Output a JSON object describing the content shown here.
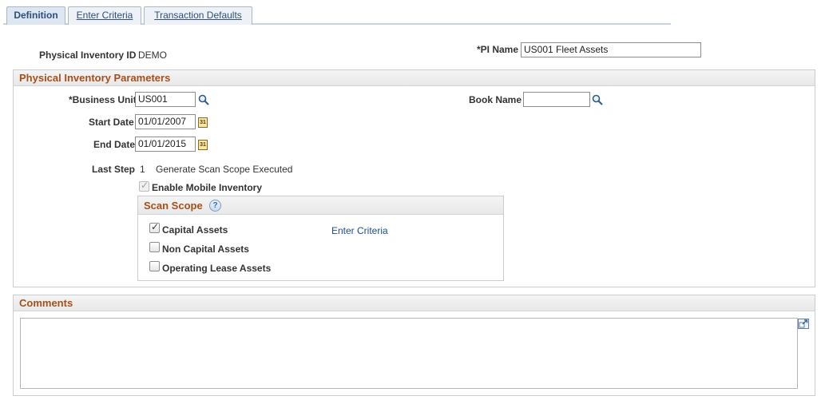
{
  "tabs": [
    {
      "label": "Definition",
      "active": true
    },
    {
      "label": "Enter Criteria",
      "active": false
    },
    {
      "label": "Transaction Defaults",
      "active": false
    }
  ],
  "header": {
    "pi_id_label": "Physical Inventory ID",
    "pi_id_value": "DEMO",
    "pi_name_label": "*PI Name",
    "pi_name_value": "US001 Fleet Assets"
  },
  "params": {
    "title": "Physical Inventory Parameters",
    "business_unit_label": "*Business Unit",
    "business_unit_value": "US001",
    "book_name_label": "Book Name",
    "book_name_value": "",
    "start_date_label": "Start Date",
    "start_date_value": "01/01/2007",
    "end_date_label": "End Date",
    "end_date_value": "01/01/2015",
    "last_step_label": "Last Step",
    "last_step_number": "1",
    "last_step_text": "Generate Scan Scope Executed",
    "enable_mobile_label": "Enable Mobile Inventory",
    "enable_mobile_checked": true,
    "calendar_glyph": "31"
  },
  "scan_scope": {
    "title": "Scan Scope",
    "help_glyph": "?",
    "enter_criteria_link": "Enter Criteria",
    "items": [
      {
        "label": "Capital Assets",
        "checked": true
      },
      {
        "label": "Non Capital Assets",
        "checked": false
      },
      {
        "label": "Operating Lease Assets",
        "checked": false
      }
    ]
  },
  "comments": {
    "title": "Comments",
    "value": ""
  },
  "colors": {
    "section_title": "#a6501b",
    "link": "#1a4e8f",
    "tab_text": "#2e4f7a"
  }
}
